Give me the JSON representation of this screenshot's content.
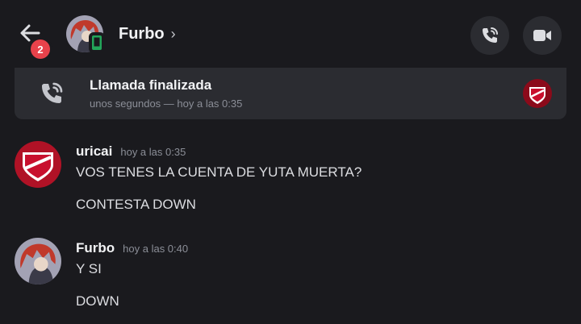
{
  "header": {
    "title": "Furbo",
    "chevron": "›",
    "unread_count": "2",
    "icons": {
      "back": "arrow-left-icon",
      "call": "phone-call-icon",
      "video": "video-camera-icon",
      "status": "mobile-online-icon"
    }
  },
  "call_card": {
    "title": "Llamada finalizada",
    "subtitle": "unos segundos — hoy a las 0:35"
  },
  "messages": [
    {
      "author": "uricai",
      "time": "hoy a las 0:35",
      "lines": [
        "VOS TENES LA CUENTA DE YUTA MUERTA?",
        "CONTESTA DOWN"
      ]
    },
    {
      "author": "Furbo",
      "time": "hoy a las 0:40",
      "lines": [
        "Y SI",
        "DOWN"
      ]
    }
  ],
  "colors": {
    "background": "#1a1a1e",
    "card": "#2b2c31",
    "badge": "#e8424b",
    "online_green": "#23a55a",
    "club_red": "#c8102e"
  }
}
